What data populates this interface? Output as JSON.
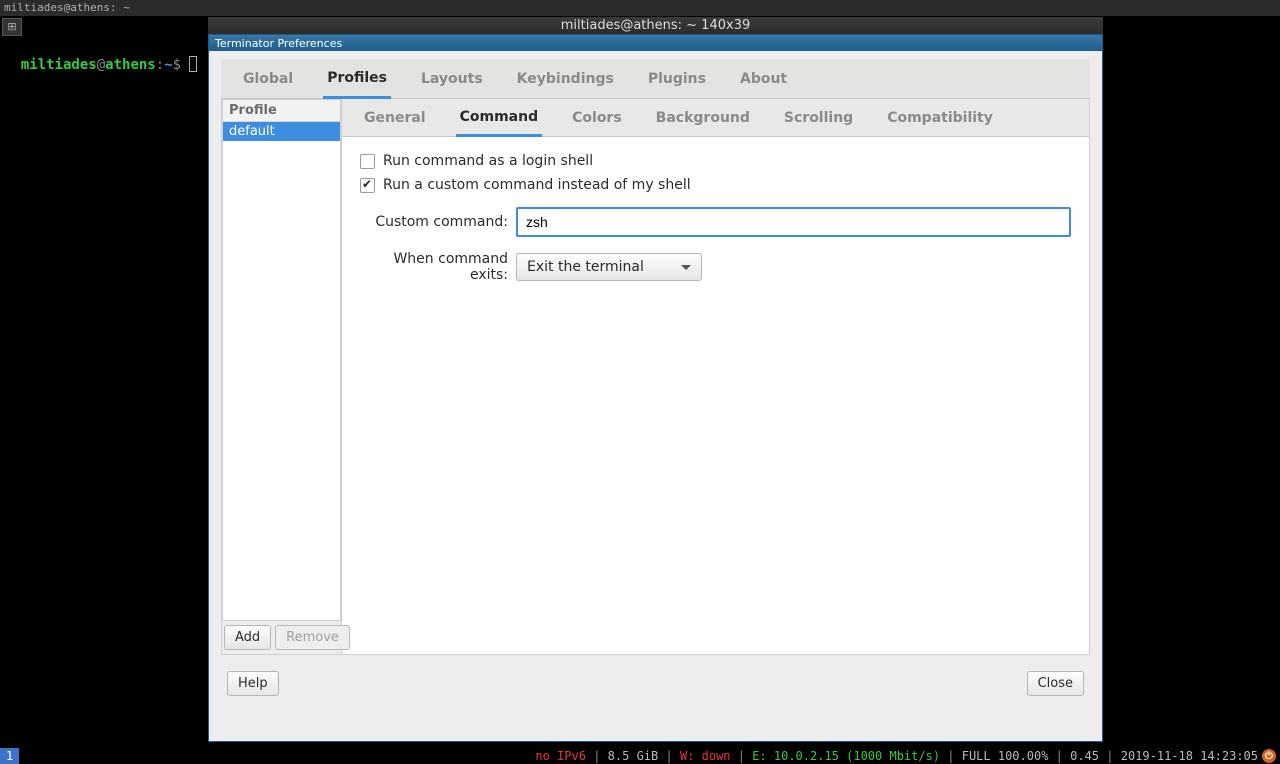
{
  "window_top_title": "miltiades@athens: ~",
  "terminator_title": "miltiades@athens: ~ 140x39",
  "prompt": {
    "user": "miltiades",
    "at": "@",
    "host": "athens",
    "colon": ":",
    "path": "~",
    "sym": "$"
  },
  "prefs": {
    "title": "Terminator Preferences",
    "tabs": [
      "Global",
      "Profiles",
      "Layouts",
      "Keybindings",
      "Plugins",
      "About"
    ],
    "active_tab": "Profiles",
    "sidebar": {
      "header": "Profile",
      "items": [
        "default"
      ],
      "selected": "default"
    },
    "sidebar_buttons": {
      "add": "Add",
      "remove": "Remove"
    },
    "inner_tabs": [
      "General",
      "Command",
      "Colors",
      "Background",
      "Scrolling",
      "Compatibility"
    ],
    "active_inner": "Command",
    "form": {
      "login_shell": {
        "label": "Run command as a login shell",
        "checked": false
      },
      "custom_cmd_enable": {
        "label": "Run a custom command instead of my shell",
        "checked": true
      },
      "custom_cmd_label": "Custom command:",
      "custom_cmd_value": "zsh",
      "on_exit_label": "When command exits:",
      "on_exit_value": "Exit the terminal"
    },
    "help": "Help",
    "close": "Close"
  },
  "status": {
    "workspace": "1",
    "ipv6": "no IPv6",
    "mem": "8.5 GiB",
    "wifi_label": "W:",
    "wifi_value": " down",
    "eth_label": "E:",
    "eth_value": " 10.0.2.15 (1000 Mbit/s)",
    "bat": "FULL 100.00%",
    "load": "0.45",
    "date": "2019-11-18 14:23:05"
  }
}
